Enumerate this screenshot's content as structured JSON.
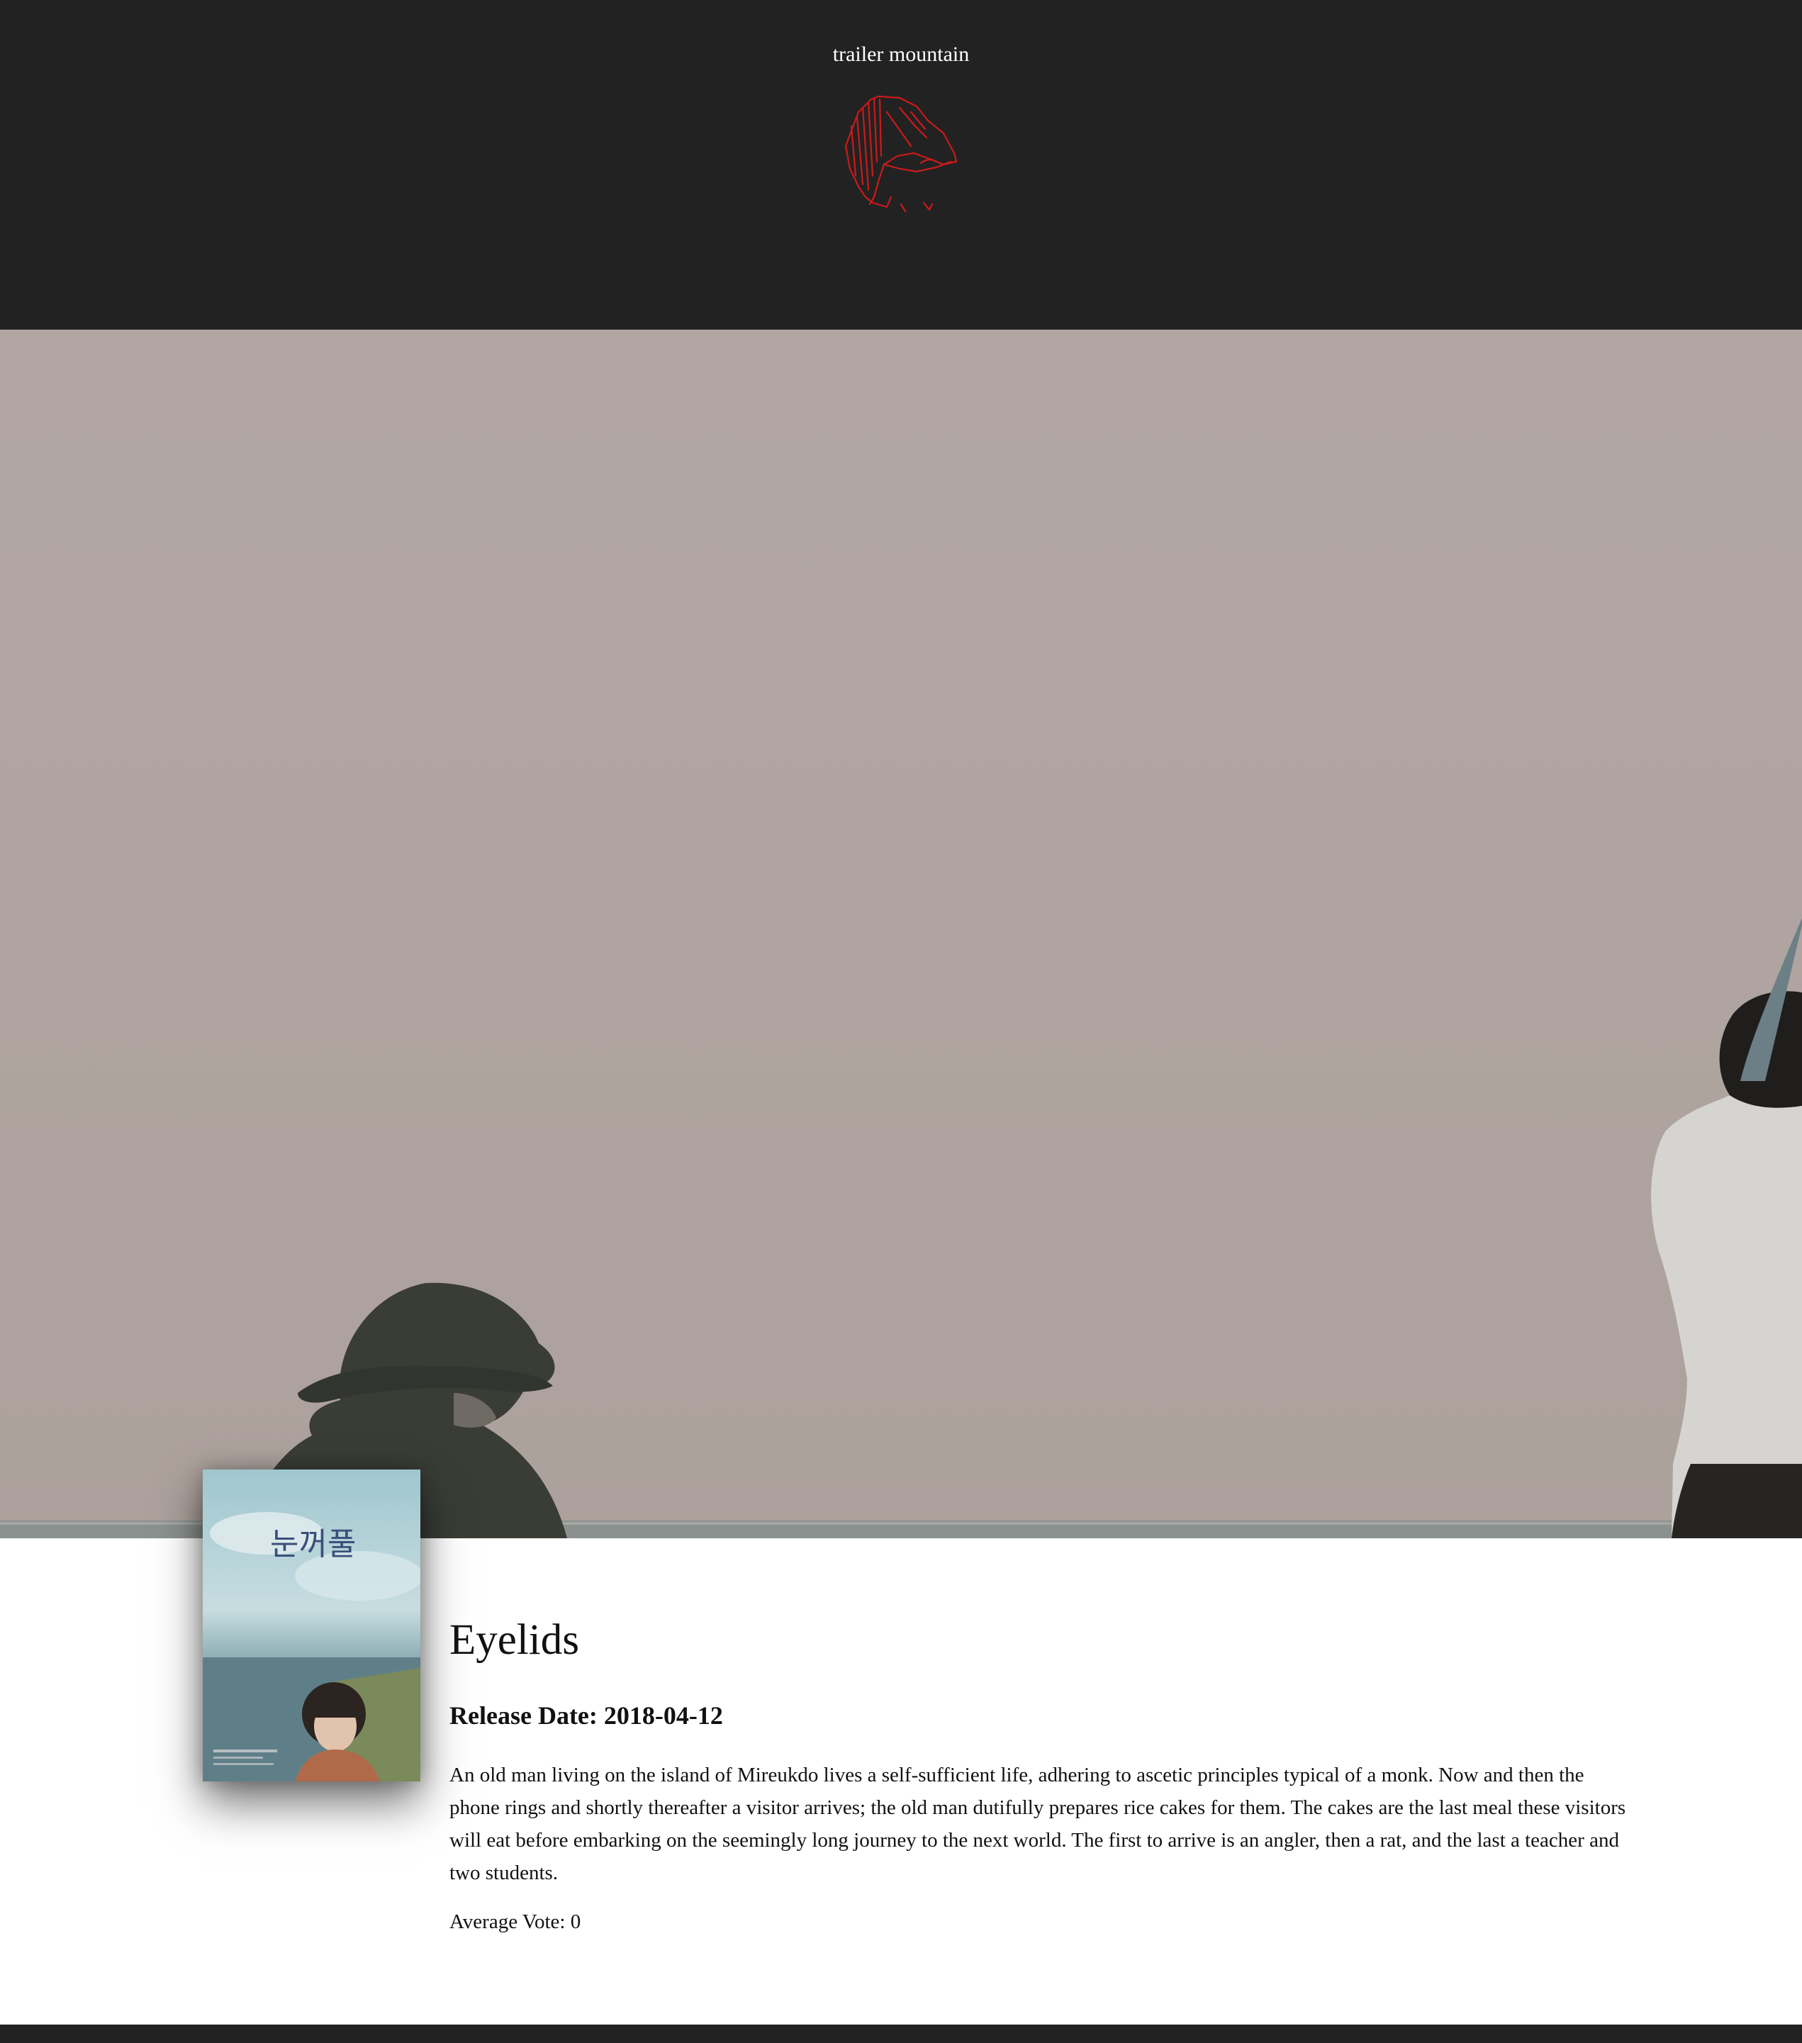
{
  "header": {
    "site_title": "trailer mountain",
    "logo_icon": "mountain-logo-icon",
    "background": "#222222",
    "logo_color": "#cc1a1a"
  },
  "hero": {
    "image_icon": "movie-backdrop-image"
  },
  "movie": {
    "poster_icon": "movie-poster-image",
    "title": "Eyelids",
    "release_label": "Release Date: 2018-04-12",
    "overview": "An old man living on the island of Mireukdo lives a self-sufficient life, adhering to ascetic principles typical of a monk. Now and then the phone rings and shortly thereafter a visitor arrives; the old man dutifully prepares rice cakes for them. The cakes are the last meal these visitors will eat before embarking on the seemingly long journey to the next world. The first to arrive is an angler, then a rat, and the last a teacher and two students.",
    "average_vote": "Average Vote: 0"
  },
  "footer": {
    "background": "#222222"
  }
}
